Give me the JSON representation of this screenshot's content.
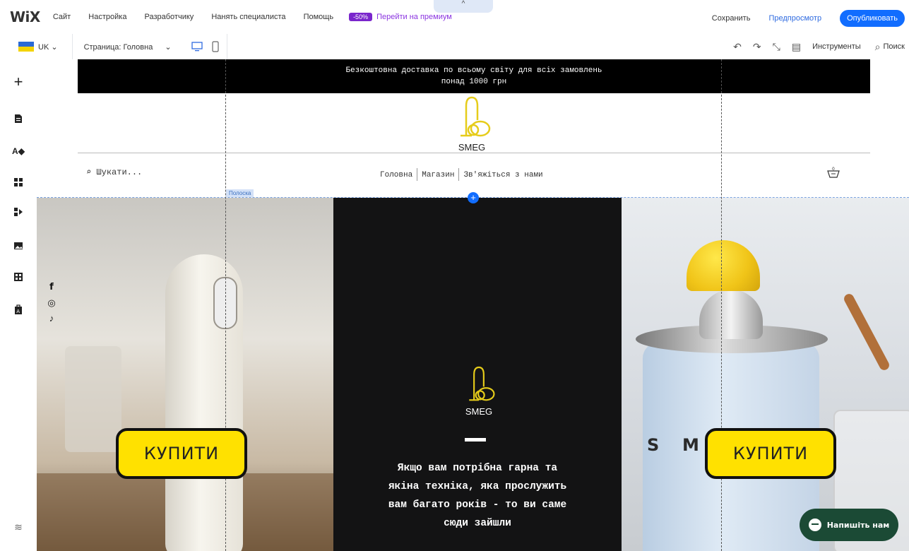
{
  "editor": {
    "logo": "WiX",
    "menu": [
      "Сайт",
      "Настройка",
      "Разработчику",
      "Нанять специалиста",
      "Помощь"
    ],
    "promo_badge": "-50%",
    "promo_link": "Перейти на премиум",
    "save": "Сохранить",
    "preview": "Предпросмотр",
    "publish": "Опубликовать",
    "collapse_glyph": "^"
  },
  "toolbar": {
    "lang": "UK",
    "page_selector": "Страница: Головна",
    "tools": "Инструменты",
    "search": "Поиск"
  },
  "site": {
    "announcement_line1": "Безкоштовна доставка по всьому світу для всіх замовлень",
    "announcement_line2": "понад 1000 грн",
    "brand": "SMEG",
    "search_placeholder": "Шукати...",
    "nav": [
      "Головна",
      "Магазин",
      "Зв'яжіться з нами"
    ],
    "strip_label": "Полоска",
    "buy_left": "КУПИТИ",
    "buy_right": "КУПИТИ",
    "mid_brand": "SMEG",
    "mid_text": "Якщо вам потрібна гарна та якіна техніка, яка прослужить вам багато років - то ви саме сюди зайшли",
    "chat": "Напишіть нам",
    "social": [
      "f",
      "◎",
      "♪"
    ],
    "product_letter_s": "S",
    "product_letter_m": "M"
  },
  "colors": {
    "accent_blue": "#116dff",
    "promo_purple": "#7a26cc",
    "buy_yellow": "#ffe100",
    "chat_green": "#1b4a35"
  }
}
